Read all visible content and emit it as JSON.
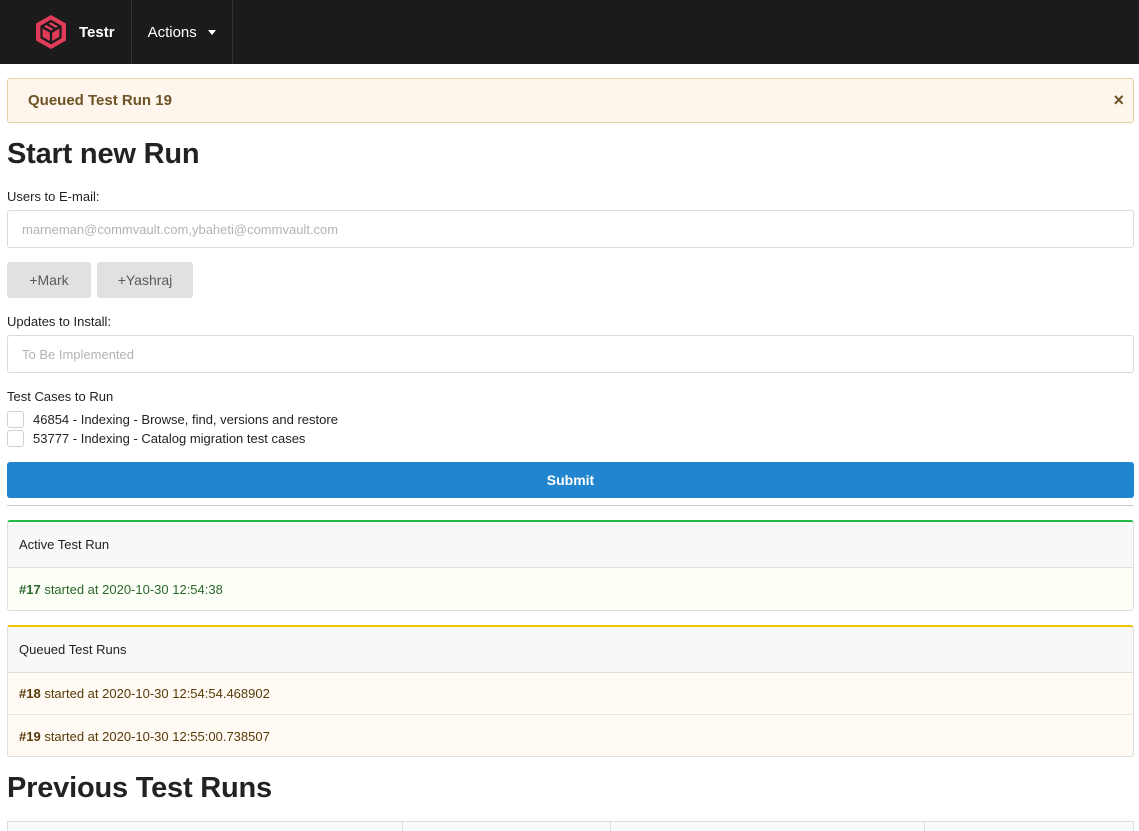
{
  "navbar": {
    "brand": "Testr",
    "brand_icon": "cube-logo-icon",
    "actions_label": "Actions"
  },
  "alert": {
    "text": "Queued Test Run 19",
    "close": "×"
  },
  "form": {
    "title": "Start new Run",
    "email_label": "Users to E-mail:",
    "email_placeholder": "marneman@commvault.com,ybaheti@commvault.com",
    "email_value": "",
    "quick_buttons": [
      "+Mark",
      "+Yashraj"
    ],
    "updates_label": "Updates to Install:",
    "updates_placeholder": "To Be Implemented",
    "updates_value": "",
    "testcases_label": "Test Cases to Run",
    "testcases": [
      {
        "label": "46854 - Indexing - Browse, find, versions and restore",
        "checked": false
      },
      {
        "label": "53777 - Indexing - Catalog migration test cases",
        "checked": false
      }
    ],
    "submit_label": "Submit"
  },
  "active": {
    "title": "Active Test Run",
    "runs": [
      {
        "id": "#17",
        "text": " started at 2020-10-30 12:54:38"
      }
    ]
  },
  "queued": {
    "title": "Queued Test Runs",
    "runs": [
      {
        "id": "#18",
        "text": " started at 2020-10-30 12:54:54.468902"
      },
      {
        "id": "#19",
        "text": " started at 2020-10-30 12:55:00.738507"
      }
    ]
  },
  "previous": {
    "title": "Previous Test Runs"
  },
  "colors": {
    "navbar_bg": "#1b1b1b",
    "brand_accent": "#e03c5a",
    "primary": "#2185d0",
    "active_border": "#21ba45",
    "queued_border": "#f0c300",
    "alert_bg": "#fef6ec"
  }
}
